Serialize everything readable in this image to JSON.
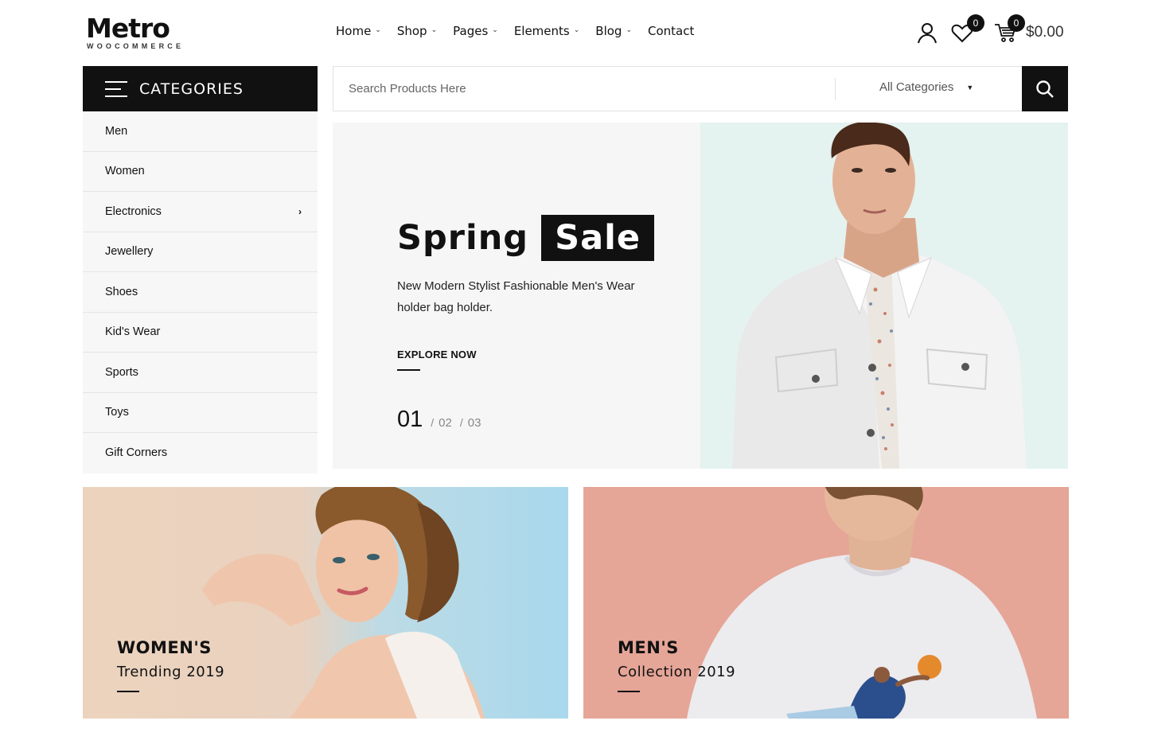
{
  "brand": {
    "name": "Metro",
    "tagline": "WOOCOMMERCE"
  },
  "nav": [
    {
      "label": "Home",
      "has_dropdown": true
    },
    {
      "label": "Shop",
      "has_dropdown": true
    },
    {
      "label": "Pages",
      "has_dropdown": true
    },
    {
      "label": "Elements",
      "has_dropdown": true
    },
    {
      "label": "Blog",
      "has_dropdown": true
    },
    {
      "label": "Contact",
      "has_dropdown": false
    }
  ],
  "header_icons": {
    "account_icon": "user-icon",
    "wishlist_icon": "heart-icon",
    "wishlist_count": "0",
    "cart_icon": "cart-icon",
    "cart_count": "0",
    "cart_total": "$0.00"
  },
  "categories": {
    "title": "CATEGORIES",
    "items": [
      {
        "label": "Men",
        "has_submenu": false
      },
      {
        "label": "Women",
        "has_submenu": false
      },
      {
        "label": "Electronics",
        "has_submenu": true
      },
      {
        "label": "Jewellery",
        "has_submenu": false
      },
      {
        "label": "Shoes",
        "has_submenu": false
      },
      {
        "label": "Kid's Wear",
        "has_submenu": false
      },
      {
        "label": "Sports",
        "has_submenu": false
      },
      {
        "label": "Toys",
        "has_submenu": false
      },
      {
        "label": "Gift Corners",
        "has_submenu": false
      }
    ]
  },
  "search": {
    "placeholder": "Search Products Here",
    "category_selected": "All Categories",
    "button_icon": "search-icon"
  },
  "hero": {
    "title_word1": "Spring",
    "title_word2": "Sale",
    "description": "New Modern Stylist Fashionable Men's Wear holder bag holder.",
    "cta": "EXPLORE NOW",
    "slide_current": "01",
    "slide_2": "02",
    "slide_3": "03",
    "slide_separator": "/"
  },
  "promos": [
    {
      "title": "WOMEN'S",
      "subtitle": "Trending 2019"
    },
    {
      "title": "MEN'S",
      "subtitle": "Collection 2019"
    }
  ],
  "colors": {
    "primary": "#111111",
    "hero_image_bg": "#e4f2f0",
    "promo_women_bg": "#ecd3bd",
    "promo_men_bg": "#e5a597"
  }
}
